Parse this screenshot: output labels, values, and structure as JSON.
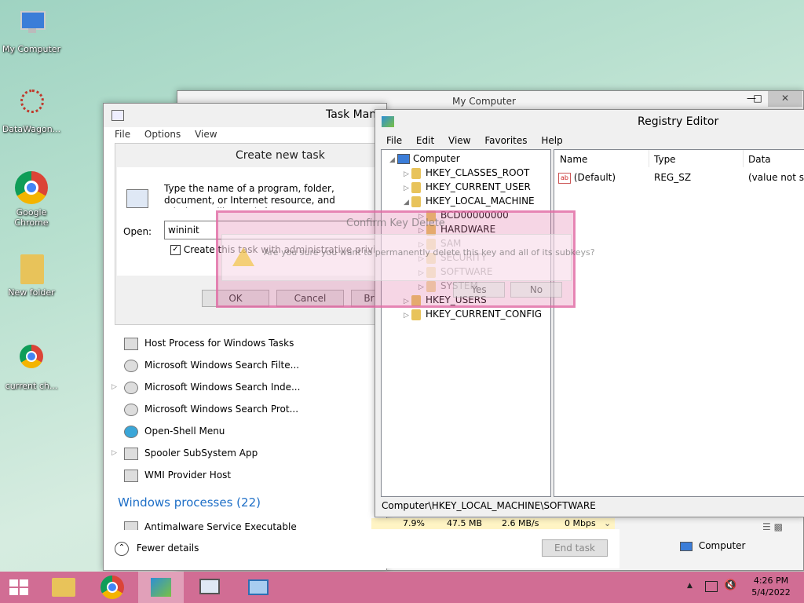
{
  "desktop": {
    "icons": [
      {
        "label": "My Computer"
      },
      {
        "label": "DataWagon..."
      },
      {
        "label": "Google Chrome"
      },
      {
        "label": "New folder"
      },
      {
        "label": "current ch..."
      }
    ]
  },
  "explorer_window": {
    "title": "My Computer",
    "status_item": "Computer"
  },
  "task_manager": {
    "title": "Task Man",
    "menu": [
      "File",
      "Options",
      "View"
    ],
    "processes": [
      "Host Process for Windows Tasks",
      "Microsoft Windows Search Filte...",
      "Microsoft Windows Search Inde...",
      "Microsoft Windows Search Prot...",
      "Open-Shell Menu",
      "Spooler SubSystem App",
      "WMI Provider Host"
    ],
    "section_title": "Windows processes (22)",
    "partial_row": {
      "name": "Antimalware Service Executable",
      "cpu": "7.9%",
      "memory": "47.5 MB",
      "disk": "2.6 MB/s",
      "network": "0 Mbps"
    },
    "fewer_details": "Fewer details",
    "end_task": "End task"
  },
  "create_task": {
    "title": "Create new task",
    "description": "Type the name of a program, folder, document, or Internet resource, and Windows will open it for you.",
    "open_label": "Open:",
    "open_value": "wininit",
    "admin_checkbox": "Create this task with administrative privileges.",
    "ok": "OK",
    "cancel": "Cancel",
    "browse": "Br"
  },
  "confirm_dialog": {
    "title": "Confirm Key Delete",
    "message": "Are you sure you want to permanently delete this key and all of its subkeys?",
    "yes": "Yes",
    "no": "No"
  },
  "registry": {
    "title": "Registry Editor",
    "menu": [
      "File",
      "Edit",
      "View",
      "Favorites",
      "Help"
    ],
    "tree": {
      "root": "Computer",
      "hives": [
        "HKEY_CLASSES_ROOT",
        "HKEY_CURRENT_USER",
        "HKEY_LOCAL_MACHINE"
      ],
      "subkeys": [
        "BCD00000000",
        "HARDWARE",
        "SAM",
        "SECURITY",
        "SOFTWARE",
        "SYSTEM"
      ],
      "hives_after": [
        "HKEY_USERS",
        "HKEY_CURRENT_CONFIG"
      ]
    },
    "columns": {
      "name": "Name",
      "type": "Type",
      "data": "Data"
    },
    "values": [
      {
        "name": "(Default)",
        "type": "REG_SZ",
        "data": "(value not set)"
      }
    ],
    "status": "Computer\\HKEY_LOCAL_MACHINE\\SOFTWARE"
  },
  "tray": {
    "time": "4:26 PM",
    "date": "5/4/2022"
  },
  "colors": {
    "taskbar": "#d16d94",
    "accent_blue": "#1e6fc7",
    "confirm_overlay": "#e06aa3"
  }
}
